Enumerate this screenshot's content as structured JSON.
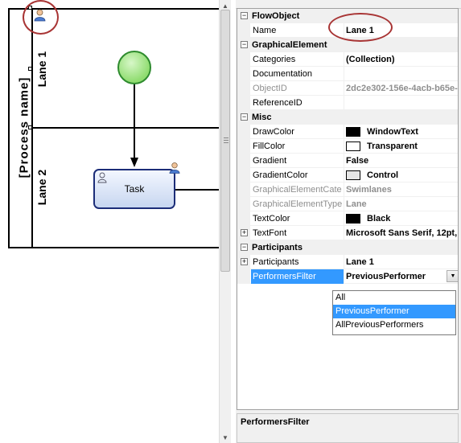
{
  "diagram": {
    "pool_title": "[Process  name]",
    "lane1_label": "Lane 1",
    "lane2_label": "Lane 2",
    "task_label": "Task"
  },
  "propertyGrid": {
    "rows": [
      {
        "type": "cat",
        "name": "FlowObject"
      },
      {
        "type": "prop",
        "name": "Name",
        "value": "Lane 1"
      },
      {
        "type": "cat",
        "name": "GraphicalElement"
      },
      {
        "type": "prop",
        "name": "Categories",
        "value": "(Collection)"
      },
      {
        "type": "prop",
        "name": "Documentation",
        "value": ""
      },
      {
        "type": "prop",
        "name": "ObjectID",
        "value": "2dc2e302-156e-4acb-b65e-",
        "disabled": true
      },
      {
        "type": "prop",
        "name": "ReferenceID",
        "value": ""
      },
      {
        "type": "cat",
        "name": "Misc"
      },
      {
        "type": "prop",
        "name": "DrawColor",
        "value": "WindowText",
        "swatch": "#000000"
      },
      {
        "type": "prop",
        "name": "FillColor",
        "value": "Transparent",
        "swatch": "#ffffff"
      },
      {
        "type": "prop",
        "name": "Gradient",
        "value": "False"
      },
      {
        "type": "prop",
        "name": "GradientColor",
        "value": "Control",
        "swatch": "#e6e6e6"
      },
      {
        "type": "prop",
        "name": "GraphicalElementCate",
        "value": "Swimlanes",
        "disabled": true
      },
      {
        "type": "prop",
        "name": "GraphicalElementType",
        "value": "Lane",
        "disabled": true
      },
      {
        "type": "prop",
        "name": "TextColor",
        "value": "Black",
        "swatch": "#000000"
      },
      {
        "type": "prop",
        "name": "TextFont",
        "value": "Microsoft Sans Serif, 12pt,",
        "expander": "+"
      },
      {
        "type": "cat",
        "name": "Participants"
      },
      {
        "type": "prop",
        "name": "Participants",
        "value": "Lane 1",
        "expander": "+"
      },
      {
        "type": "prop",
        "name": "PerformersFilter",
        "value": "PreviousPerformer",
        "selected": true,
        "dropdown": true
      }
    ],
    "dropdown_options": [
      "All",
      "PreviousPerformer",
      "AllPreviousPerformers"
    ],
    "dropdown_selected_index": 1,
    "description_title": "PerformersFilter"
  },
  "colors": {
    "selection": "#3399ff",
    "annotation_circle": "#a83434",
    "start_event_fill": "#8fdc6f",
    "task_border": "#1c2d78"
  },
  "icons": {
    "participant": "participant-icon",
    "dropdown": "chevron-down-icon",
    "expand": "plus-icon",
    "collapse": "minus-icon"
  }
}
